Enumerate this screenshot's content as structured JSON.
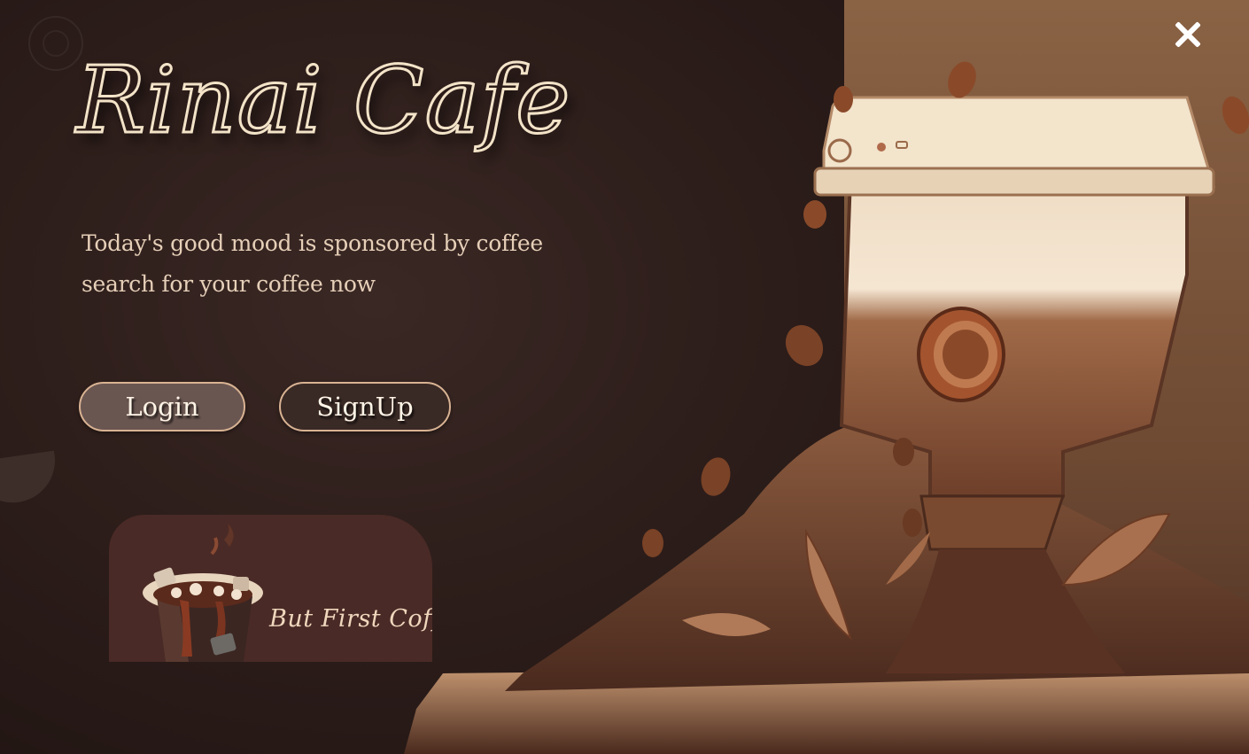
{
  "brand": {
    "title": "Rinai Cafe"
  },
  "hero": {
    "tagline_line1": "Today's good mood is sponsored by coffee",
    "tagline_line2": "search for your coffee now"
  },
  "actions": {
    "login_label": "Login",
    "signup_label": "SignUp"
  },
  "promo": {
    "caption": "But First Coffee"
  },
  "window": {
    "close_icon": "close-icon"
  },
  "colors": {
    "background": "#2a1b18",
    "accent": "#d9b393",
    "title_outline": "#f3e3c8",
    "panel": "#8a6244"
  }
}
